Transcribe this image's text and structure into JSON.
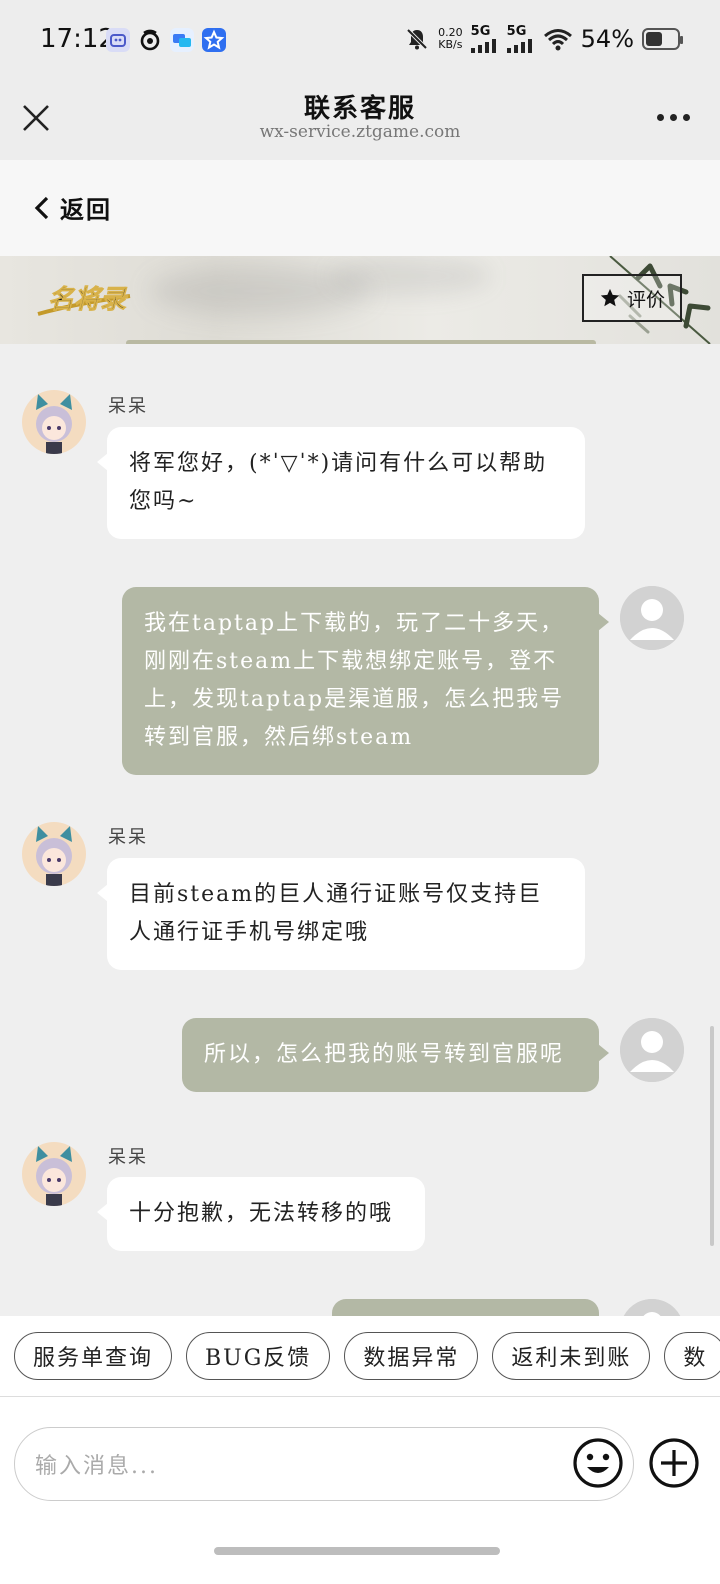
{
  "status_bar": {
    "time": "17:12",
    "net_speed_value": "0.20",
    "net_speed_unit": "KB/s",
    "signal1": "5G",
    "signal2": "5G",
    "battery_text": "54%",
    "battery_level": 0.54
  },
  "titlebar": {
    "title": "联系客服",
    "subtitle": "wx-service.ztgame.com"
  },
  "backbar": {
    "back_label": "返回"
  },
  "banner": {
    "rate_label": "评价"
  },
  "messages": [
    {
      "from": "agent",
      "sender": "呆呆",
      "text": "将军您好，(*ˈ▽ˈ*)请问有什么可以帮助您吗~"
    },
    {
      "from": "user",
      "text": "我在taptap上下载的，玩了二十多天，刚刚在steam上下载想绑定账号，登不上，发现taptap是渠道服，怎么把我号转到官服，然后绑steam"
    },
    {
      "from": "agent",
      "sender": "呆呆",
      "text": "目前steam的巨人通行证账号仅支持巨人通行证手机号绑定哦"
    },
    {
      "from": "user",
      "text": "所以，怎么把我的账号转到官服呢"
    },
    {
      "from": "agent",
      "sender": "呆呆",
      "text": "十分抱歉，无法转移的哦"
    }
  ],
  "quick_replies": [
    "服务单查询",
    "BUG反馈",
    "数据异常",
    "返利未到账",
    "数"
  ],
  "input": {
    "placeholder": "输入消息..."
  },
  "colors": {
    "user_bubble": "#b3b8a5",
    "agent_bubble": "#ffffff",
    "page_bg": "#efefef"
  }
}
